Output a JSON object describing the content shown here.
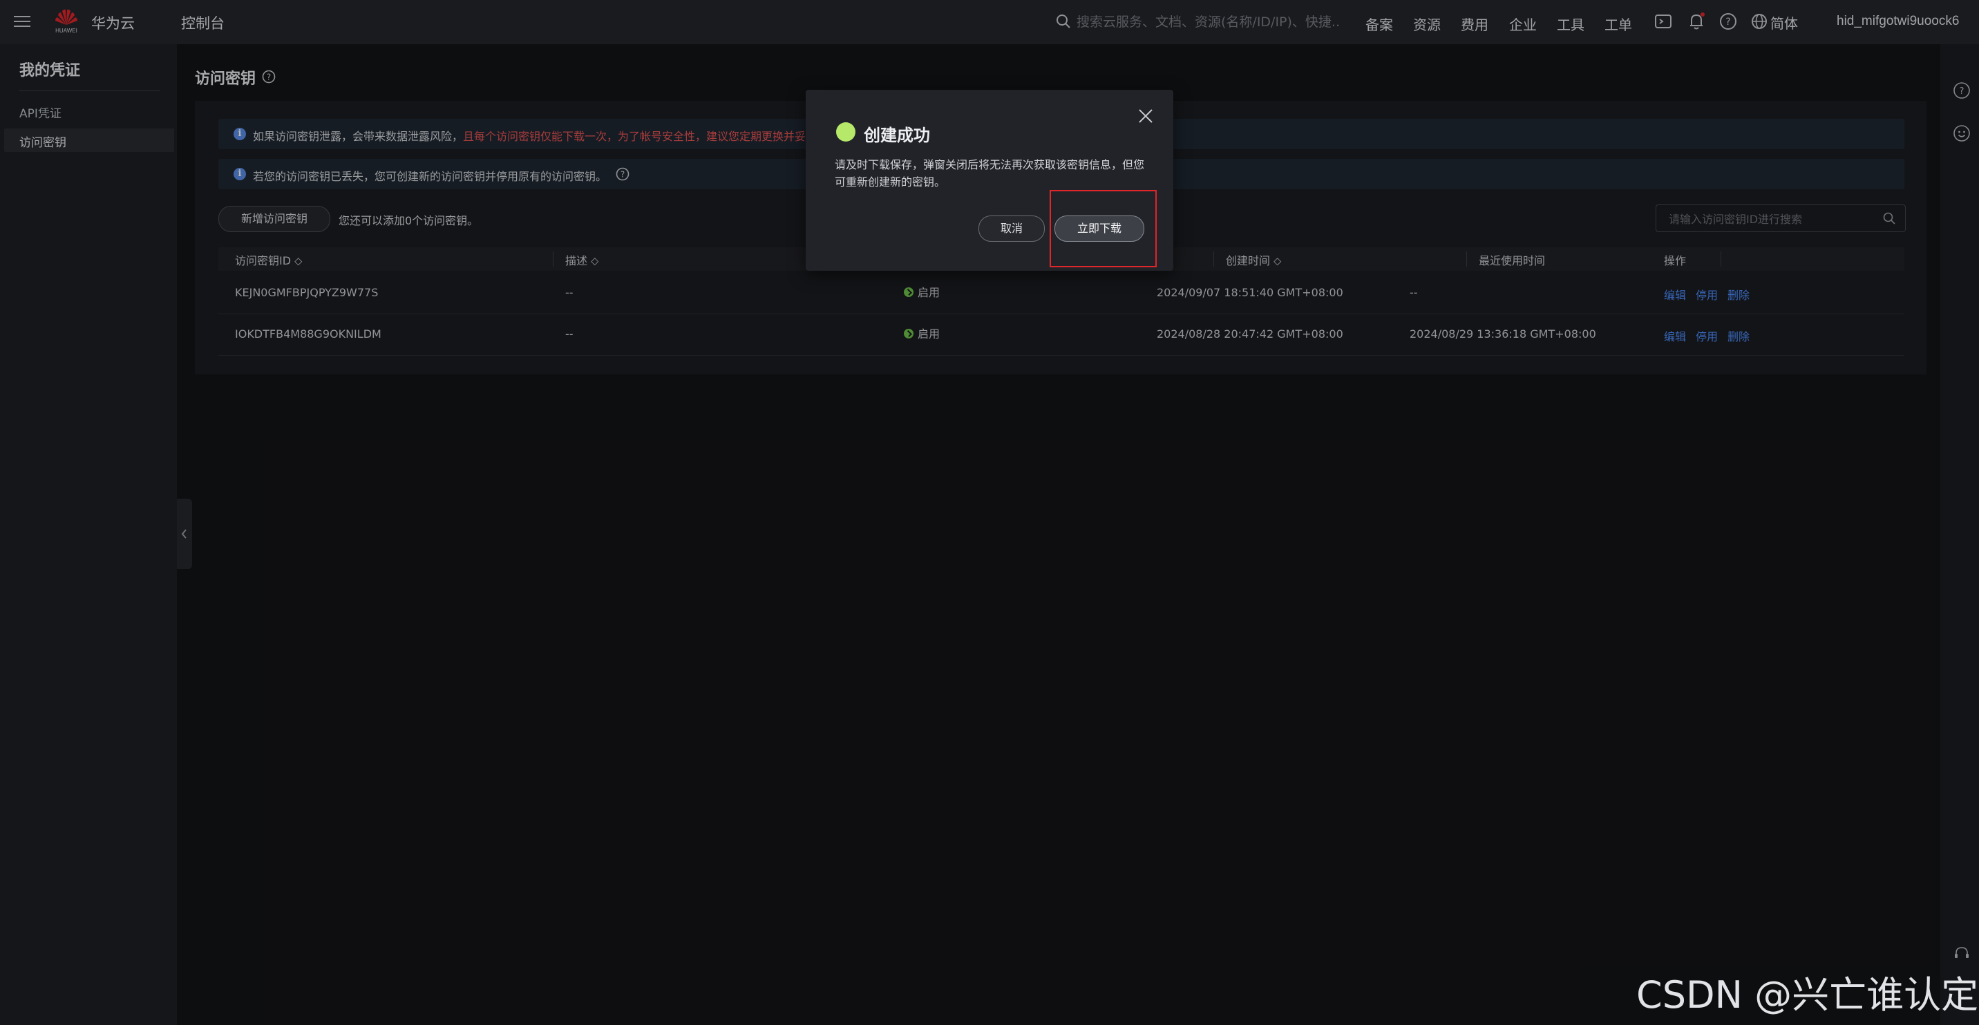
{
  "header": {
    "logo_text": "HUAWEI",
    "brand": "华为云",
    "console": "控制台",
    "search_placeholder": "搜索云服务、文档、资源(名称/ID/IP)、快捷...",
    "nav": [
      "备案",
      "资源",
      "费用",
      "企业",
      "工具",
      "工单"
    ],
    "language": "简体",
    "username": "hid_mifgotwi9uoock6"
  },
  "sidebar": {
    "title": "我的凭证",
    "items": [
      "API凭证",
      "访问密钥"
    ],
    "active": "访问密钥"
  },
  "page": {
    "title": "访问密钥",
    "alerts": [
      {
        "text": "如果访问密钥泄露，会带来数据泄露风险，",
        "warning": "且每个访问密钥仅能下载一次，为了帐号安全性，建议您定期更换并妥"
      },
      {
        "text": "若您的访问密钥已丢失，您可创建新的访问密钥并停用原有的访问密钥。"
      }
    ],
    "new_key_button": "新增访问密钥",
    "quota_text": "您还可以添加0个访问密钥。",
    "search_placeholder": "请输入访问密钥ID进行搜索"
  },
  "table": {
    "headers": [
      "访问密钥ID",
      "描述",
      "",
      "创建时间",
      "最近使用时间",
      "操作"
    ],
    "rows": [
      {
        "id": "KEJN0GMFBPJQPYZ9W77S",
        "desc": "--",
        "status": "启用",
        "created": "2024/09/07 18:51:40 GMT+08:00",
        "last_used": "--",
        "actions": [
          "编辑",
          "停用",
          "删除"
        ]
      },
      {
        "id": "IOKDTFB4M88G9OKNILDM",
        "desc": "--",
        "status": "启用",
        "created": "2024/08/28 20:47:42 GMT+08:00",
        "last_used": "2024/08/29 13:36:18 GMT+08:00",
        "actions": [
          "编辑",
          "停用",
          "删除"
        ]
      }
    ]
  },
  "dialog": {
    "title": "创建成功",
    "message": "请及时下载保存，弹窗关闭后将无法再次获取该密钥信息，但您可重新创建新的密钥。",
    "cancel": "取消",
    "download": "立即下载"
  },
  "watermark": "CSDN @兴亡谁认定",
  "colors": {
    "accent": "#4d8eff",
    "success": "#b6e86a",
    "status_on": "#6ec24a",
    "warning": "#e85454",
    "highlight": "#e0262b"
  }
}
